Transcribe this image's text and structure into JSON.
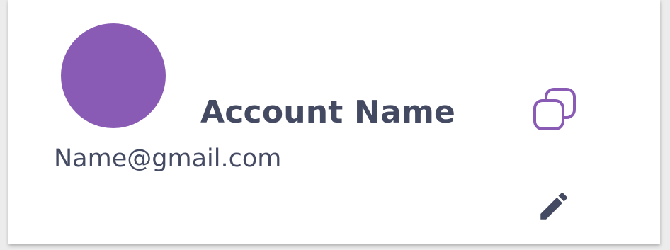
{
  "account": {
    "name": "Account Name",
    "email": "Name@gmail.com"
  },
  "icons": {
    "copy": "copy-icon",
    "edit": "pencil-icon"
  },
  "colors": {
    "avatar": "#8a5bb4",
    "text": "#454a63",
    "copy_icon": "#8a5bb4",
    "edit_icon": "#454a63"
  }
}
